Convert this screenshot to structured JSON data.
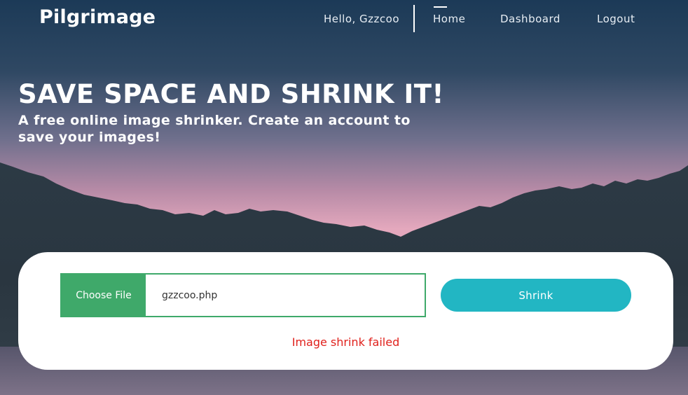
{
  "brand": "Pilgrimage",
  "nav": {
    "greeting": "Hello, Gzzcoo",
    "home": "Home",
    "dashboard": "Dashboard",
    "logout": "Logout"
  },
  "hero": {
    "title": "SAVE SPACE AND SHRINK IT!",
    "subtitle": "A free online image shrinker. Create an account to save your images!"
  },
  "form": {
    "choose_file_label": "Choose File",
    "file_name": "gzzcoo.php",
    "shrink_label": "Shrink",
    "error_message": "Image shrink failed"
  },
  "colors": {
    "accent_green": "#3fa96a",
    "accent_teal": "#22b6c3",
    "error_red": "#e0211c",
    "sky_top": "#1e3a56",
    "sky_bottom": "#e4a8bd"
  }
}
